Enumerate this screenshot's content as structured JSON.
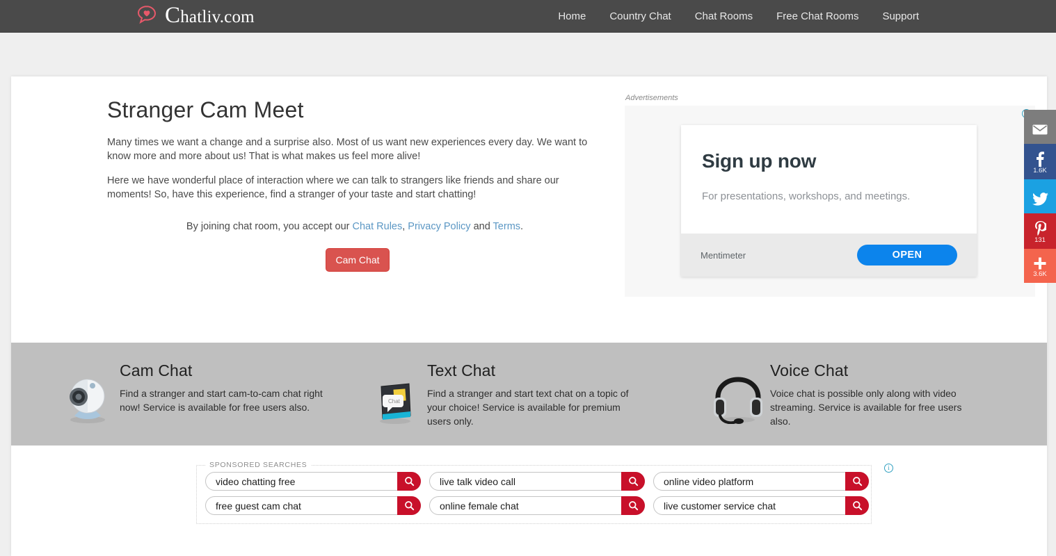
{
  "site": {
    "brand_initial": "C",
    "brand_rest": "hatliv.com",
    "logo_icon": "heart-speech-bubble-icon"
  },
  "nav": {
    "items": [
      {
        "label": "Home"
      },
      {
        "label": "Country Chat"
      },
      {
        "label": "Chat Rooms"
      },
      {
        "label": "Free Chat Rooms"
      },
      {
        "label": "Support"
      }
    ]
  },
  "hero": {
    "title": "Stranger Cam Meet",
    "paragraph1": "Many times we want a change and a surprise also. Most of us want new experiences every day. We want to know more and more about us! That is what makes us feel more alive!",
    "paragraph2": "Here we have wonderful place of interaction where we can talk to strangers like friends and share our moments! So, have this experience, find a stranger of your taste and start chatting!",
    "terms_prefix": "By joining chat room, you accept our ",
    "terms_link1": "Chat Rules",
    "terms_sep1": ", ",
    "terms_link2": "Privacy Policy",
    "terms_sep2": " and ",
    "terms_link3": "Terms",
    "terms_suffix": ".",
    "cta_label": "Cam Chat"
  },
  "ad": {
    "label": "Advertisements",
    "info_glyph": "i",
    "headline": "Sign up now",
    "subtitle": "For presentations, workshops, and meetings.",
    "brand": "Mentimeter",
    "button_label": "OPEN"
  },
  "share": {
    "items": [
      {
        "name": "email",
        "icon": "envelope-icon",
        "count": "",
        "color": "#7d7d7d"
      },
      {
        "name": "facebook",
        "icon": "facebook-icon",
        "count": "1.6K",
        "color": "#33538f"
      },
      {
        "name": "twitter",
        "icon": "twitter-icon",
        "count": "",
        "color": "#1ba1e2"
      },
      {
        "name": "pinterest",
        "icon": "pinterest-icon",
        "count": "131",
        "color": "#c8232c"
      },
      {
        "name": "more",
        "icon": "plus-icon",
        "count": "3.6K",
        "color": "#f4644d"
      }
    ]
  },
  "features": [
    {
      "icon": "webcam-icon",
      "title": "Cam Chat",
      "text": "Find a stranger and start cam-to-cam chat right now! Service is available for free users also."
    },
    {
      "icon": "text-chat-icon",
      "title": "Text Chat",
      "text": "Find a stranger and start text chat on a topic of your choice! Service is available for premium users only."
    },
    {
      "icon": "headset-icon",
      "title": "Voice Chat",
      "text": "Voice chat is possible only along with video streaming. Service is available for free users also."
    }
  ],
  "sponsored": {
    "legend": "SPONSORED SEARCHES",
    "info_glyph": "i",
    "search_icon": "magnifier-icon",
    "items": [
      {
        "value": "video chatting free"
      },
      {
        "value": "live talk video call"
      },
      {
        "value": "online video platform"
      },
      {
        "value": "free guest cam chat"
      },
      {
        "value": "online female chat"
      },
      {
        "value": "live customer service chat"
      }
    ]
  },
  "colors": {
    "navbar": "#4a4a4a",
    "accent_red": "#d9534f",
    "link_blue": "#5b97c4",
    "ad_blue": "#0c84ec",
    "features_band": "#bfbfbf",
    "search_red": "#c8102a",
    "info_teal": "#31a0c0"
  }
}
